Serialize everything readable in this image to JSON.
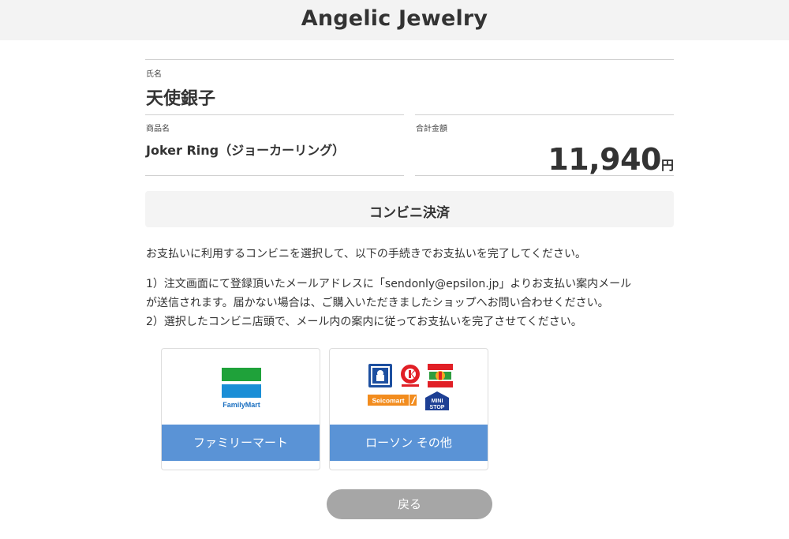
{
  "header": {
    "title": "Angelic Jewelry"
  },
  "customer": {
    "name_label": "氏名",
    "name": "天使銀子"
  },
  "product": {
    "label": "商品名",
    "name": "Joker Ring（ジョーカーリング）"
  },
  "total": {
    "label": "合計金額",
    "amount": "11,940",
    "currency": "円"
  },
  "payment": {
    "method_title": "コンビニ決済",
    "instruction": "お支払いに利用するコンビニを選択して、以下の手続きでお支払いを完了してください。",
    "steps": [
      "1）注文画面にて登録頂いたメールアドレスに「sendonly@epsilon.jp」よりお支払い案内メール",
      "が送信されます。届かない場合は、ご購入いただきましたショップへお問い合わせください。",
      "2）選択したコンビニ店頭で、メール内の案内に従ってお支払いを完了させてください。"
    ]
  },
  "stores": [
    {
      "label": "ファミリーマート",
      "logo_text": "FamilyMart",
      "logo": "familymart-logo"
    },
    {
      "label": "ローソン その他",
      "logos": [
        "lawson-logo",
        "circle-k-logo",
        "sunkus-logo",
        "seicomart-logo",
        "ministop-logo"
      ],
      "seicomart_text": "Seicomart",
      "ministop_text": [
        "MINI",
        "STOP"
      ]
    }
  ],
  "buttons": {
    "back": "戻る"
  },
  "colors": {
    "header_bg": "#f3f3f3",
    "store_button": "#5a93d6",
    "back_button": "#a6a6a6",
    "familymart_green": "#1fa23a",
    "familymart_blue": "#1a8ed6"
  }
}
